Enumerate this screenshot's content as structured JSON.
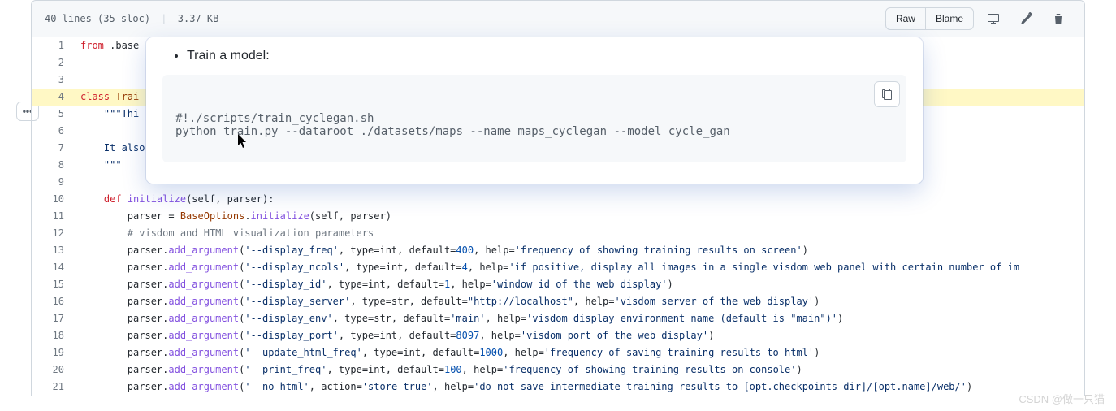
{
  "header": {
    "lines_label": "40 lines (35 sloc)",
    "size_label": "3.37 KB",
    "raw_label": "Raw",
    "blame_label": "Blame"
  },
  "gutter_btn": "•••",
  "popover": {
    "bullet": "Train a model:",
    "snippet_line1": "#!./scripts/train_cyclegan.sh",
    "snippet_line2": "python train.py --dataroot ./datasets/maps --name maps_cyclegan --model cycle_gan"
  },
  "code": {
    "line1": {
      "kw_from": "from",
      "mod": " .base",
      "rest": ""
    },
    "line4": {
      "kw_class": "class",
      "name": " Trai",
      "rest": ""
    },
    "line5": {
      "indent": "    ",
      "str": "\"\"\"Thi",
      "rest": ""
    },
    "line7": {
      "indent": "    ",
      "text": "It also includes shared options defined in BaseOptions."
    },
    "line8": {
      "indent": "    ",
      "str": "\"\"\""
    },
    "line10": {
      "indent": "    ",
      "kw_def": "def",
      "name": " initialize",
      "args": "(self, parser):"
    },
    "line11": {
      "indent": "        ",
      "pre": "parser = ",
      "cls": "BaseOptions",
      "dot": ".",
      "fn": "initialize",
      "post": "(self, parser)"
    },
    "line12": {
      "indent": "        ",
      "comment": "# visdom and HTML visualization parameters"
    },
    "line13": {
      "indent": "        ",
      "pre": "parser.",
      "fn": "add_argument",
      "p1": "(",
      "s1": "'--display_freq'",
      "p2": ", type=int, default=",
      "num": "400",
      "p3": ", help=",
      "s2": "'frequency of showing training results on screen'",
      "p4": ")"
    },
    "line14": {
      "indent": "        ",
      "pre": "parser.",
      "fn": "add_argument",
      "p1": "(",
      "s1": "'--display_ncols'",
      "p2": ", type=int, default=",
      "num": "4",
      "p3": ", help=",
      "s2": "'if positive, display all images in a single visdom web panel with certain number of im",
      "p4": ""
    },
    "line15": {
      "indent": "        ",
      "pre": "parser.",
      "fn": "add_argument",
      "p1": "(",
      "s1": "'--display_id'",
      "p2": ", type=int, default=",
      "num": "1",
      "p3": ", help=",
      "s2": "'window id of the web display'",
      "p4": ")"
    },
    "line16": {
      "indent": "        ",
      "pre": "parser.",
      "fn": "add_argument",
      "p1": "(",
      "s1": "'--display_server'",
      "p2": ", type=str, default=",
      "s3": "\"http://localhost\"",
      "p3": ", help=",
      "s2": "'visdom server of the web display'",
      "p4": ")"
    },
    "line17": {
      "indent": "        ",
      "pre": "parser.",
      "fn": "add_argument",
      "p1": "(",
      "s1": "'--display_env'",
      "p2": ", type=str, default=",
      "s3": "'main'",
      "p3": ", help=",
      "s2": "'visdom display environment name (default is \"main\")'",
      "p4": ")"
    },
    "line18": {
      "indent": "        ",
      "pre": "parser.",
      "fn": "add_argument",
      "p1": "(",
      "s1": "'--display_port'",
      "p2": ", type=int, default=",
      "num": "8097",
      "p3": ", help=",
      "s2": "'visdom port of the web display'",
      "p4": ")"
    },
    "line19": {
      "indent": "        ",
      "pre": "parser.",
      "fn": "add_argument",
      "p1": "(",
      "s1": "'--update_html_freq'",
      "p2": ", type=int, default=",
      "num": "1000",
      "p3": ", help=",
      "s2": "'frequency of saving training results to html'",
      "p4": ")"
    },
    "line20": {
      "indent": "        ",
      "pre": "parser.",
      "fn": "add_argument",
      "p1": "(",
      "s1": "'--print_freq'",
      "p2": ", type=int, default=",
      "num": "100",
      "p3": ", help=",
      "s2": "'frequency of showing training results on console'",
      "p4": ")"
    },
    "line21": {
      "indent": "        ",
      "pre": "parser.",
      "fn": "add_argument",
      "p1": "(",
      "s1": "'--no_html'",
      "p2": ", action=",
      "s3": "'store_true'",
      "p3": ", help=",
      "s2": "'do not save intermediate training results to [opt.checkpoints_dir]/[opt.name]/web/'",
      "p4": ")"
    }
  },
  "watermark": "CSDN @做一只猫"
}
